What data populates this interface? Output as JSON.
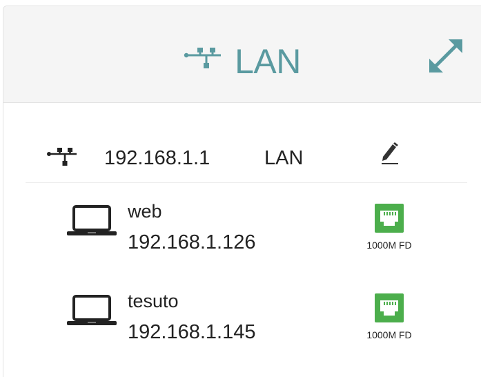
{
  "header": {
    "icon": "network-icon",
    "title": "LAN",
    "expand_icon": "expand-icon"
  },
  "lan": {
    "icon": "network-icon",
    "ip": "192.168.1.1",
    "name": "LAN",
    "edit_icon": "edit-pencil-icon"
  },
  "clients": [
    {
      "icon": "laptop-icon",
      "name": "web",
      "ip": "192.168.1.126",
      "port_icon": "ethernet-port-icon",
      "port_speed": "1000M FD",
      "port_color": "#4cae4c"
    },
    {
      "icon": "laptop-icon",
      "name": "tesuto",
      "ip": "192.168.1.145",
      "port_icon": "ethernet-port-icon",
      "port_speed": "1000M FD",
      "port_color": "#4cae4c"
    }
  ],
  "colors": {
    "accent": "#5a9aa0",
    "header_bg": "#f5f5f5",
    "port_green": "#4cae4c"
  }
}
